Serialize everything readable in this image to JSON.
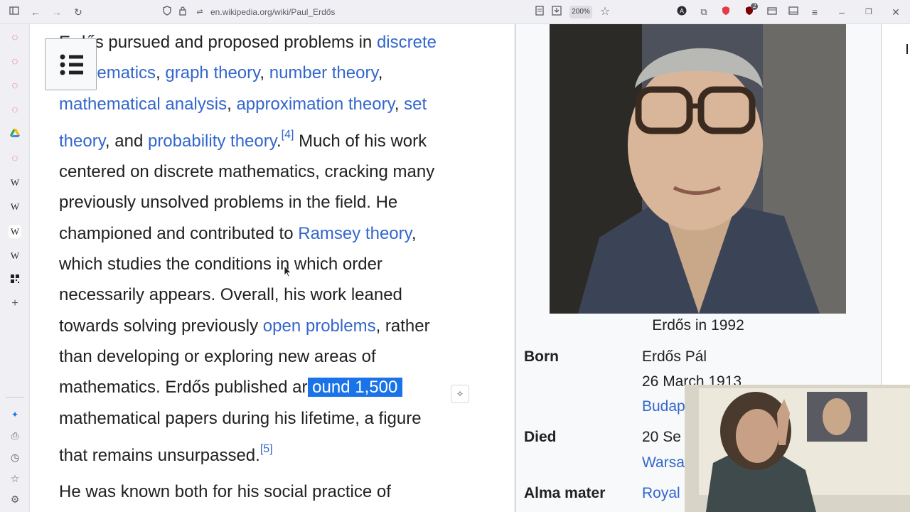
{
  "browser": {
    "url": "en.wikipedia.org/wiki/Paul_Erdős",
    "zoom": "200%",
    "extension_badge": "2"
  },
  "sidebar": {
    "icons": [
      "sidebar-toggle-icon",
      "tab-icon",
      "tab-icon",
      "tab-icon",
      "tab-icon",
      "drive-icon",
      "tab-icon",
      "wikipedia-icon",
      "wikipedia-icon",
      "wikipedia-icon",
      "wikipedia-icon",
      "qr-icon",
      "plus-icon",
      "ai-sparkle-icon",
      "screenshot-icon",
      "history-icon",
      "bookmark-icon",
      "settings-icon"
    ],
    "wiki_letter": "W"
  },
  "article": {
    "l1_text": "Erdős pursued and proposed problems in ",
    "l1_link": "discrete",
    "l2_link1": "mathematics",
    "l2_link2": "graph theory",
    "l2_link3": "number theory",
    "l3_link1": "mathematical analysis",
    "l3_link2": "approximation theory",
    "l3_link3": "set",
    "l4_link1": "theory",
    "l4_text1": ", and ",
    "l4_link2": "probability theory",
    "l4_ref": "[4]",
    "l4_text2": " Much of his work",
    "l5": "centered on discrete mathematics, cracking many",
    "l6": "previously unsolved problems in the field. He",
    "l7_text": "championed and contributed to ",
    "l7_link": "Ramsey theory",
    "l8": "which studies the conditions in which order",
    "l9": "necessarily appears. Overall, his work leaned",
    "l10_text": "towards solving previously ",
    "l10_link": "open problems",
    "l10_text2": ", rather",
    "l11": "than developing or exploring new areas of",
    "l12_text": "mathematics. Erdős published ar",
    "l12_highlight": "ound 1,500",
    "l13": "mathematical papers during his lifetime, a figure",
    "l14_text": "that remains unsurpassed.",
    "l14_ref": "[5]",
    "l15": "He was known both for his social practice of"
  },
  "infobox": {
    "caption": "Erdős in 1992",
    "born_label": "Born",
    "born_name": "Erdős Pál",
    "born_date": "26 March 1913",
    "born_place": "Budap",
    "died_label": "Died",
    "died_date": "20 Se",
    "died_place": "Warsa",
    "alma_label": "Alma mater",
    "alma_value": "Royal"
  }
}
